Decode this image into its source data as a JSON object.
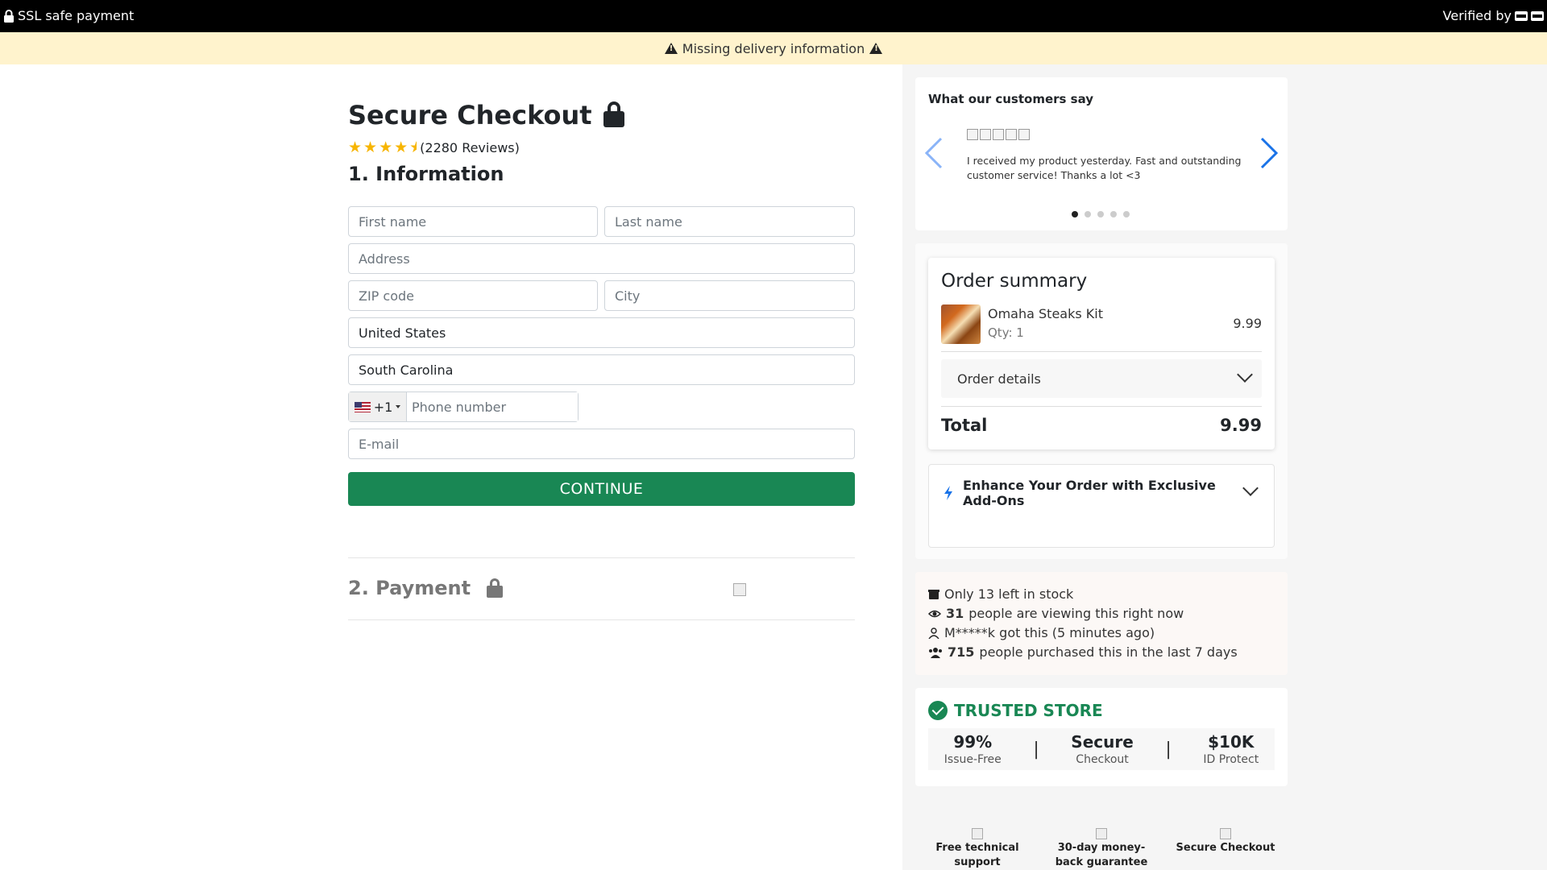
{
  "topbar": {
    "ssl_text": "SSL safe payment",
    "verified_text": "Verified by"
  },
  "alert": {
    "text": "Missing delivery information"
  },
  "checkout": {
    "title": "Secure Checkout",
    "rating_stars": 4.5,
    "reviews": "(2280 Reviews)",
    "step1": "1. Information",
    "step2": "2. Payment",
    "continue_label": "CONTINUE"
  },
  "form": {
    "first_name": {
      "placeholder": "First name",
      "value": ""
    },
    "last_name": {
      "placeholder": "Last name",
      "value": ""
    },
    "address": {
      "placeholder": "Address",
      "value": ""
    },
    "zip": {
      "placeholder": "ZIP code",
      "value": ""
    },
    "city": {
      "placeholder": "City",
      "value": ""
    },
    "country": {
      "value": "United States"
    },
    "state": {
      "value": "South Carolina"
    },
    "phone": {
      "code": "+1",
      "placeholder": "Phone number"
    },
    "email": {
      "placeholder": "E-mail",
      "value": ""
    }
  },
  "testimonial": {
    "heading": "What our customers say",
    "text": "I received my product yesterday. Fast and outstanding customer service! Thanks a lot <3",
    "slides": 5,
    "active_slide": 1
  },
  "order": {
    "title": "Order summary",
    "item_name": "Omaha Steaks Kit",
    "item_qty": "Qty: 1",
    "item_price": "9.99",
    "details_label": "Order details",
    "total_label": "Total",
    "total_value": "9.99",
    "addons_title": "Enhance Your Order with Exclusive Add-Ons"
  },
  "social": {
    "stock": "Only 13 left in stock",
    "viewers_count": "31",
    "viewers_text": "people are viewing this right now",
    "recent": "M*****k got this (5 minutes ago)",
    "purchased_count": "715",
    "purchased_text": "people purchased this in the last 7 days"
  },
  "trusted": {
    "title": "TRUSTED STORE",
    "stats": [
      {
        "value": "99%",
        "label": "Issue-Free"
      },
      {
        "value": "Secure",
        "label": "Checkout"
      },
      {
        "value": "$10K",
        "label": "ID Protect"
      }
    ],
    "separator": "|"
  },
  "badges": [
    {
      "label": "Free technical support"
    },
    {
      "label": "30-day money-back guarantee"
    },
    {
      "label": "Secure Checkout"
    }
  ],
  "colors": {
    "accent_green": "#198754",
    "alert_bg": "#fff3cd",
    "star": "#f7b500",
    "arrow_blue": "#1a73e8"
  }
}
